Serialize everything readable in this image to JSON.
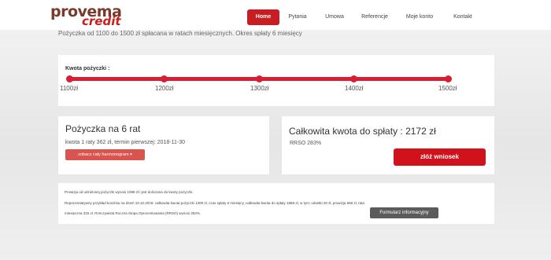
{
  "logo": {
    "top": "provema",
    "bottom": "credit"
  },
  "tagline": "Pożyczka od 1100 do 1500 zł spłacana w ratach miesięcznych. Okres spłaty 6 miesięcy",
  "nav": [
    "Home",
    "Pytania",
    "Umowa",
    "Referencje",
    "Moje konto",
    "Kontakt"
  ],
  "slider": {
    "label": "Kwota pożyczki :",
    "ticks": [
      "1100zł",
      "1200zł",
      "1300zł",
      "1400zł",
      "1500zł"
    ],
    "selected_amount_zl": 1500
  },
  "loan_box": {
    "title": "Pożyczka na 6 rat",
    "detail": "kwota 1 raty 362 zł, termin pierwszej: 2018-11-30",
    "button": "zobacz cały harmonogram ▾"
  },
  "total_box": {
    "title": "Całkowita kwota do spłaty : 2172 zł",
    "rrso": "RRSO 283%",
    "button": "złóż wniosek"
  },
  "fine_print": [
    "Prowizja od udzielonej pożyczki wynosi 1088 zł i jest doliczana do kwoty pożyczki.",
    "Reprezentatywny przykład kosztów na dzień 10.10.2018: całkowita kwota pożyczki 1300 zł, czas spłaty 6 miesięcy, całkowita kwota do spłaty 1888 zł, w tym: odsetki 20 zł, prowizja 568 zł, rata",
    "miesięczna 315 zł, Rzeczywista Roczna Stopa Oprocentowania (RRSO) wynosi 283%."
  ],
  "form_button": "Formularz informacyjny"
}
